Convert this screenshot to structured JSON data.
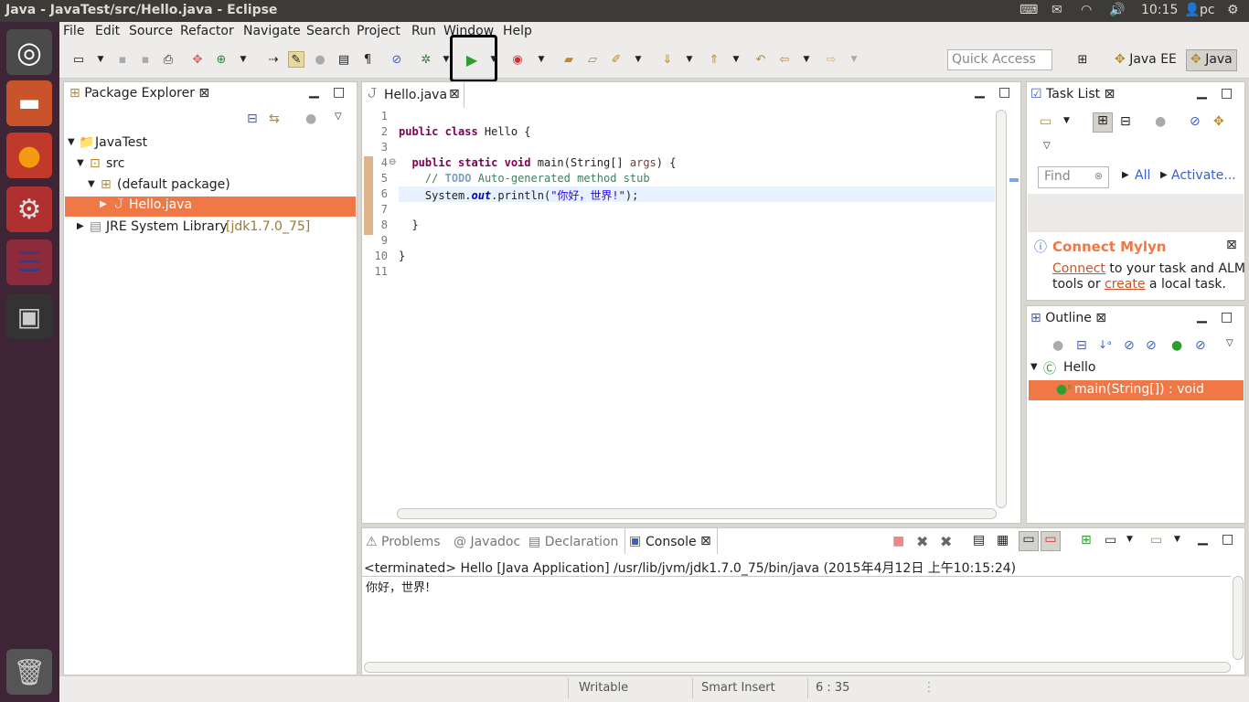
{
  "window": {
    "title": "Java - JavaTest/src/Hello.java - Eclipse"
  },
  "indicators": {
    "time": "10:15",
    "user": "pc"
  },
  "menu": [
    "File",
    "Edit",
    "Source",
    "Refactor",
    "Navigate",
    "Search",
    "Project",
    "Run",
    "Window",
    "Help"
  ],
  "toolbar": {
    "quick_access_placeholder": "Quick Access",
    "perspective_java_ee": "Java EE",
    "perspective_java": "Java"
  },
  "package_explorer": {
    "title": "Package Explorer",
    "project": "JavaTest",
    "src": "src",
    "default_package": "(default package)",
    "file": "Hello.java",
    "jre": "JRE System Library",
    "jre_version": "[jdk1.7.0_75]"
  },
  "editor": {
    "tab": "Hello.java",
    "line_numbers": [
      "1",
      "2",
      "3",
      "4",
      "5",
      "6",
      "7",
      "8",
      "9",
      "10",
      "11"
    ],
    "l2_kw": "public class",
    "l2_rest": " Hello {",
    "l4_kw": "public static void",
    "l4_rest": " main(String[] ",
    "l4_arg": "args",
    "l4_end": ") {",
    "l5_pre": "// ",
    "l5_todo": "TODO",
    "l5_rest": " Auto-generated method stub",
    "l6_a": "System.",
    "l6_out": "out",
    "l6_b": ".println(",
    "l6_str": "\"你好，世界!",
    "l6_end": "\");",
    "l8": "}",
    "l10": "}"
  },
  "task_list": {
    "title": "Task List",
    "find_placeholder": "Find",
    "all": "All",
    "activate": "Activate...",
    "mylyn_title": "Connect Mylyn",
    "mylyn_connect": "Connect",
    "mylyn_text1": " to your task and ALM",
    "mylyn_text2": "tools or ",
    "mylyn_create": "create",
    "mylyn_text3": " a local task."
  },
  "outline": {
    "title": "Outline",
    "class": "Hello",
    "method": "main(String[]) : void"
  },
  "bottom": {
    "tabs": [
      "Problems",
      "Javadoc",
      "Declaration",
      "Console"
    ],
    "console_header": "<terminated> Hello [Java Application] /usr/lib/jvm/jdk1.7.0_75/bin/java (2015年4月12日 上午10:15:24)",
    "console_output": "你好，世界!"
  },
  "status": {
    "writable": "Writable",
    "insert": "Smart Insert",
    "position": "6 : 35"
  },
  "colors": {
    "selection": "#f07746",
    "launcher": "#3d2536",
    "topbar": "#3c3b37"
  }
}
